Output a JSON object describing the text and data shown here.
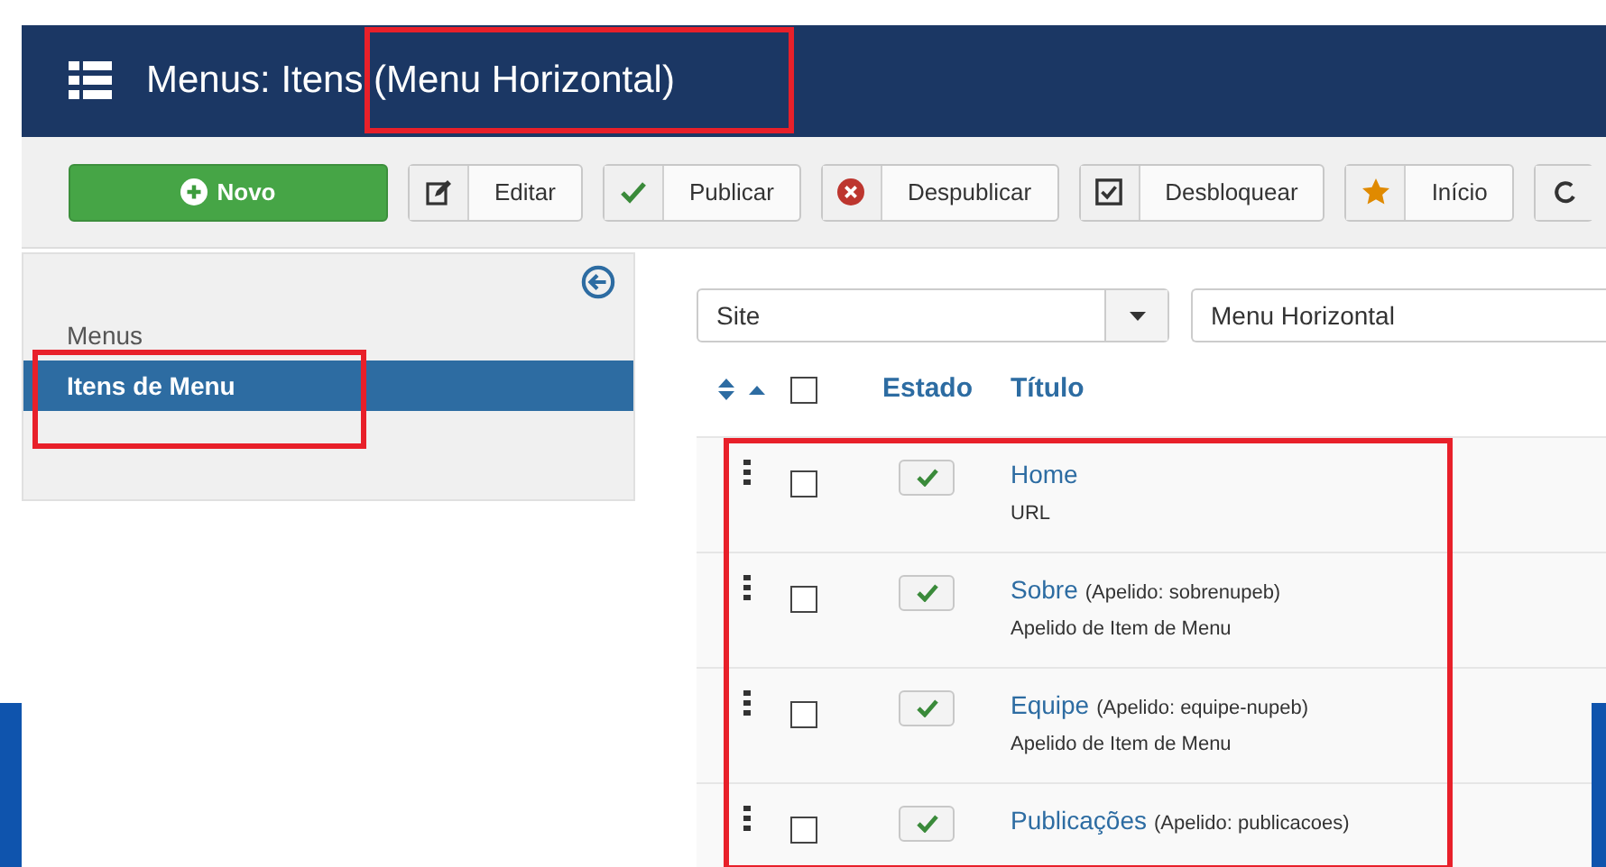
{
  "header": {
    "title": "Menus: Itens (Menu Horizontal)"
  },
  "toolbar": [
    {
      "kind": "new",
      "label": "Novo"
    },
    {
      "kind": "edit",
      "label": "Editar"
    },
    {
      "kind": "publish",
      "label": "Publicar"
    },
    {
      "kind": "unpublish",
      "label": "Despublicar"
    },
    {
      "kind": "unlock",
      "label": "Desbloquear"
    },
    {
      "kind": "home",
      "label": "Início"
    },
    {
      "kind": "refresh"
    }
  ],
  "sidebar": {
    "items": [
      {
        "label": "Menus",
        "selected": false
      },
      {
        "label": "Itens de Menu",
        "selected": true
      }
    ]
  },
  "filters": {
    "client": "Site",
    "menu": "Menu Horizontal"
  },
  "table": {
    "columns": [
      "Estado",
      "Título"
    ],
    "select_all": false,
    "rows": [
      {
        "title": "Home",
        "alias": "",
        "type": "URL",
        "checked": false,
        "published": true
      },
      {
        "title": "Sobre",
        "alias": "(Apelido: sobrenupeb)",
        "type": "Apelido de Item de Menu",
        "checked": false,
        "published": true
      },
      {
        "title": "Equipe",
        "alias": "(Apelido: equipe-nupeb)",
        "type": "Apelido de Item de Menu",
        "checked": false,
        "published": true
      },
      {
        "title": "Publicações",
        "alias": "(Apelido: publicacoes)",
        "type": "",
        "checked": false,
        "published": true
      }
    ]
  }
}
